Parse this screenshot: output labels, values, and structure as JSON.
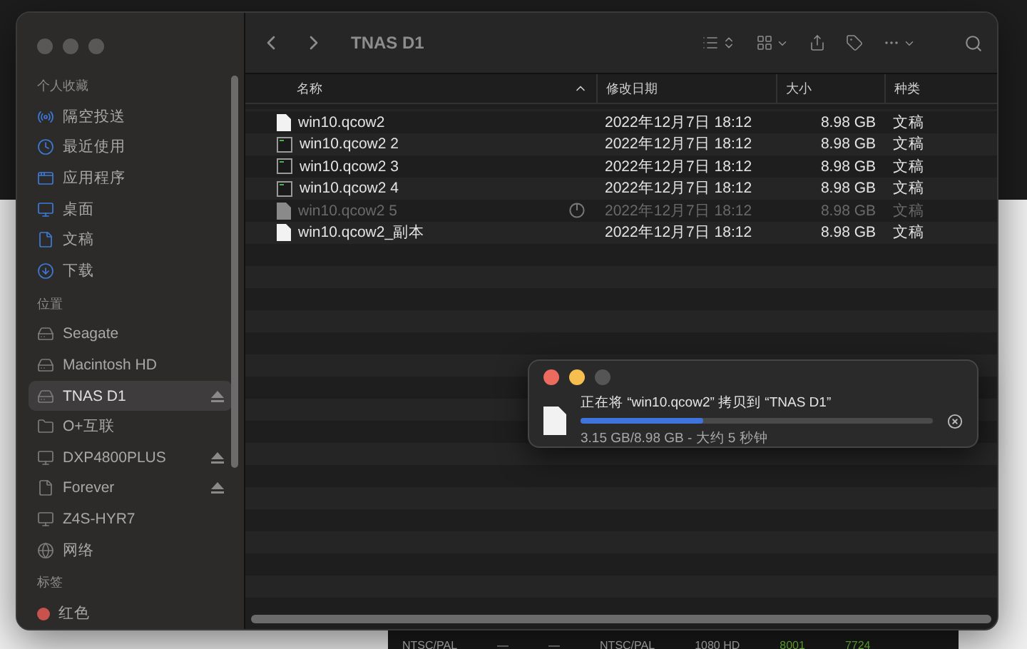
{
  "background_table": {
    "cells": [
      "NTSC/PAL",
      "—",
      "—",
      "NTSC/PAL",
      "1080 HD",
      "8001",
      "7724"
    ]
  },
  "sidebar": {
    "sections": [
      {
        "heading": "个人收藏",
        "items": [
          {
            "kind": "airdrop",
            "label": "隔空投送",
            "selected": false,
            "eject": false
          },
          {
            "kind": "recent",
            "label": "最近使用",
            "selected": false,
            "eject": false
          },
          {
            "kind": "apps",
            "label": "应用程序",
            "selected": false,
            "eject": false
          },
          {
            "kind": "desktop",
            "label": "桌面",
            "selected": false,
            "eject": false
          },
          {
            "kind": "documents",
            "label": "文稿",
            "selected": false,
            "eject": false
          },
          {
            "kind": "downloads",
            "label": "下载",
            "selected": false,
            "eject": false
          }
        ]
      },
      {
        "heading": "位置",
        "items": [
          {
            "kind": "drive",
            "label": "Seagate",
            "selected": false,
            "eject": false
          },
          {
            "kind": "drive",
            "label": "Macintosh HD",
            "selected": false,
            "eject": false
          },
          {
            "kind": "drive",
            "label": "TNAS D1",
            "selected": true,
            "eject": true
          },
          {
            "kind": "folder",
            "label": "O+互联",
            "selected": false,
            "eject": false
          },
          {
            "kind": "computer",
            "label": "DXP4800PLUS",
            "selected": false,
            "eject": true
          },
          {
            "kind": "file",
            "label": "Forever",
            "selected": false,
            "eject": true
          },
          {
            "kind": "computer",
            "label": "Z4S-HYR7",
            "selected": false,
            "eject": false
          },
          {
            "kind": "network",
            "label": "网络",
            "selected": false,
            "eject": false
          }
        ]
      },
      {
        "heading": "标签",
        "items": [
          {
            "kind": "tag",
            "label": "红色",
            "selected": false,
            "eject": false,
            "color": "#c8534c"
          }
        ]
      }
    ]
  },
  "toolbar": {
    "title": "TNAS D1"
  },
  "table": {
    "columns": [
      {
        "label": "名称",
        "sorted": true
      },
      {
        "label": "修改日期",
        "sorted": false
      },
      {
        "label": "大小",
        "sorted": false
      },
      {
        "label": "种类",
        "sorted": false
      }
    ],
    "rows": [
      {
        "kind": "document",
        "name": "win10.qcow2",
        "modified": "2022年12月7日 18:12",
        "size": "8.98 GB",
        "type": "文稿",
        "in_progress": false
      },
      {
        "kind": "terminal",
        "name": "win10.qcow2 2",
        "modified": "2022年12月7日 18:12",
        "size": "8.98 GB",
        "type": "文稿",
        "in_progress": false
      },
      {
        "kind": "terminal",
        "name": "win10.qcow2 3",
        "modified": "2022年12月7日 18:12",
        "size": "8.98 GB",
        "type": "文稿",
        "in_progress": false
      },
      {
        "kind": "terminal",
        "name": "win10.qcow2 4",
        "modified": "2022年12月7日 18:12",
        "size": "8.98 GB",
        "type": "文稿",
        "in_progress": false
      },
      {
        "kind": "document",
        "name": "win10.qcow2 5",
        "modified": "2022年12月7日 18:12",
        "size": "8.98 GB",
        "type": "文稿",
        "in_progress": true
      },
      {
        "kind": "document",
        "name": "win10.qcow2_副本",
        "modified": "2022年12月7日 18:12",
        "size": "8.98 GB",
        "type": "文稿",
        "in_progress": false
      }
    ]
  },
  "copy_dialog": {
    "message": "正在将 “win10.qcow2” 拷贝到 “TNAS D1”",
    "level": 0.35,
    "status": "3.15 GB/8.98 GB - 大约 5 秒钟"
  }
}
